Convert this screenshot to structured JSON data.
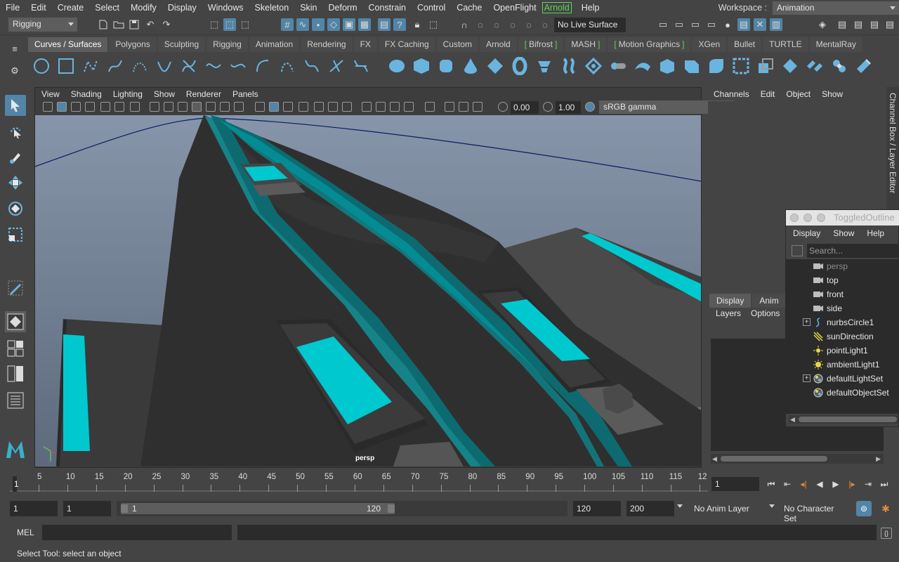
{
  "menubar": {
    "items": [
      "File",
      "Edit",
      "Create",
      "Select",
      "Modify",
      "Display",
      "Windows",
      "Skeleton",
      "Skin",
      "Deform",
      "Constrain",
      "Control",
      "Cache",
      "OpenFlight",
      "Arnold",
      "Help"
    ],
    "highlighted": "Arnold",
    "workspace_label": "Workspace :",
    "workspace_value": "Animation"
  },
  "statusline": {
    "menuset": "Rigging",
    "live_surface": "No Live Surface"
  },
  "shelf": {
    "tabs": [
      "Curves / Surfaces",
      "Polygons",
      "Sculpting",
      "Rigging",
      "Animation",
      "Rendering",
      "FX",
      "FX Caching",
      "Custom",
      "Arnold",
      "Bifrost",
      "MASH",
      "Motion Graphics",
      "XGen",
      "Bullet",
      "TURTLE",
      "MentalRay"
    ],
    "active_tab": "Curves / Surfaces"
  },
  "viewport": {
    "menus": [
      "View",
      "Shading",
      "Lighting",
      "Show",
      "Renderer",
      "Panels"
    ],
    "exposure": "0.00",
    "gamma": "1.00",
    "color_space": "sRGB gamma",
    "camera_label": "persp"
  },
  "channelbox": {
    "menus": [
      "Channels",
      "Edit",
      "Object",
      "Show"
    ],
    "side_tab": "Channel Box / Layer Editor"
  },
  "layer_editor": {
    "tabs": [
      "Display",
      "Anim"
    ],
    "active_tab": "Display",
    "menus": [
      "Layers",
      "Options"
    ]
  },
  "outliner": {
    "title": "ToggledOutline",
    "menus": [
      "Display",
      "Show",
      "Help"
    ],
    "search_placeholder": "Search...",
    "items": [
      {
        "label": "persp",
        "icon": "camera-icon",
        "expandable": false,
        "dimmed": true
      },
      {
        "label": "top",
        "icon": "camera-icon",
        "expandable": false,
        "dimmed": false
      },
      {
        "label": "front",
        "icon": "camera-icon",
        "expandable": false,
        "dimmed": false
      },
      {
        "label": "side",
        "icon": "camera-icon",
        "expandable": false,
        "dimmed": false
      },
      {
        "label": "nurbsCircle1",
        "icon": "nurbs-curve-icon",
        "expandable": true,
        "dimmed": false
      },
      {
        "label": "sunDirection",
        "icon": "directional-light-icon",
        "expandable": false,
        "dimmed": false
      },
      {
        "label": "pointLight1",
        "icon": "point-light-icon",
        "expandable": false,
        "dimmed": false
      },
      {
        "label": "ambientLight1",
        "icon": "ambient-light-icon",
        "expandable": false,
        "dimmed": false
      },
      {
        "label": "defaultLightSet",
        "icon": "set-icon",
        "expandable": true,
        "dimmed": false
      },
      {
        "label": "defaultObjectSet",
        "icon": "set-icon",
        "expandable": false,
        "dimmed": false
      }
    ]
  },
  "timeline": {
    "labels": [
      "5",
      "10",
      "15",
      "20",
      "25",
      "30",
      "35",
      "40",
      "45",
      "50",
      "55",
      "60",
      "65",
      "70",
      "75",
      "80",
      "85",
      "90",
      "95",
      "100",
      "105",
      "110",
      "115",
      "12"
    ],
    "current_frame_marker": "1",
    "current_frame": "1"
  },
  "range": {
    "start_time": "1",
    "playback_start": "1",
    "slider_start": "1",
    "slider_end": "120",
    "playback_end": "120",
    "end_time": "200",
    "anim_layer": "No Anim Layer",
    "character_set": "No Character Set"
  },
  "commandline": {
    "label": "MEL"
  },
  "helpline": {
    "text": "Select Tool: select an object"
  },
  "colors": {
    "accent": "#5285a6",
    "cyan_panel": "#00c8cf",
    "viewport_sky": "#6e7f96",
    "highlight_green": "#5fd35f"
  }
}
